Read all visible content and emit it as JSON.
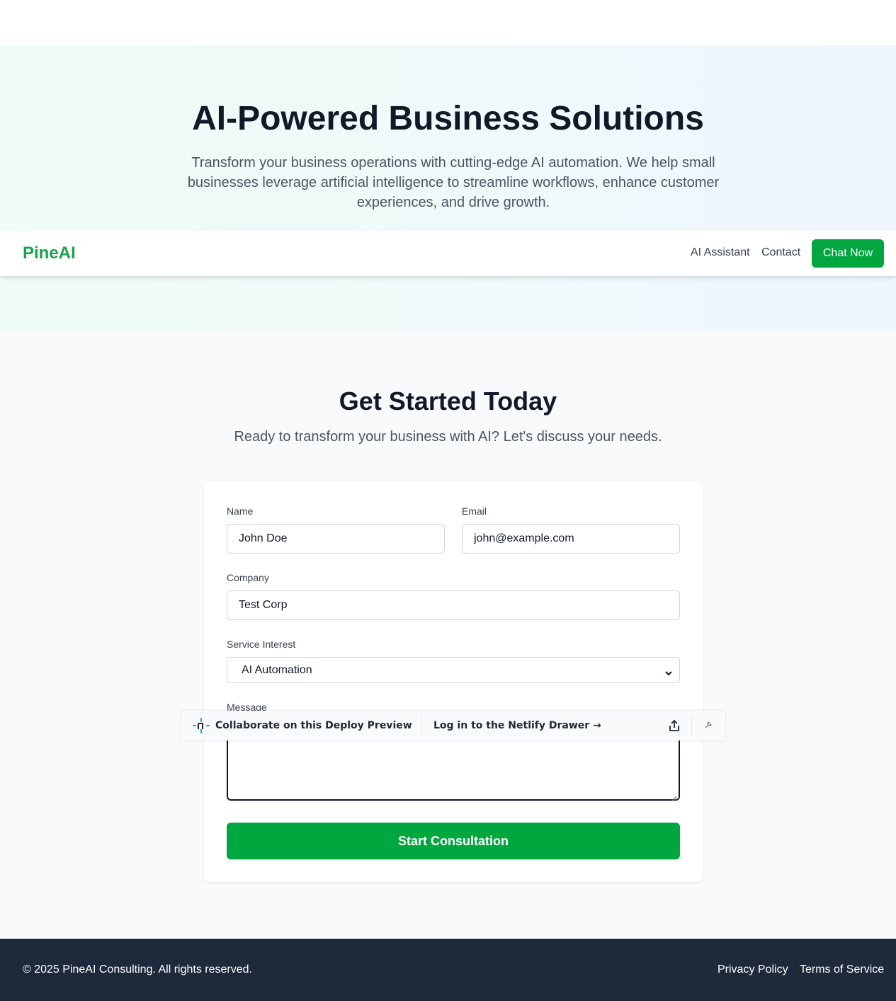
{
  "hero": {
    "title": "AI-Powered Business Solutions",
    "subtitle": "Transform your business operations with cutting-edge AI automation. We help small businesses leverage artificial intelligence to streamline workflows, enhance customer experiences, and drive growth."
  },
  "navbar": {
    "brand": "PineAI",
    "links": [
      "AI Assistant",
      "Contact"
    ],
    "cta_label": "Chat Now"
  },
  "contact": {
    "title": "Get Started Today",
    "subtitle": "Ready to transform your business with AI? Let's discuss your needs.",
    "form": {
      "name_label": "Name",
      "name_value": "John Doe",
      "email_label": "Email",
      "email_value": "john@example.com",
      "company_label": "Company",
      "company_value": "Test Corp",
      "service_label": "Service Interest",
      "service_value": "AI Automation",
      "message_label": "Message",
      "message_value": "",
      "submit_label": "Start Consultation"
    }
  },
  "netlify_drawer": {
    "collab_label": "Collaborate on this Deploy Preview",
    "login_label": "Log in to the Netlify Drawer →",
    "icons": [
      "netlify-logo-icon",
      "share-icon",
      "pin-icon"
    ]
  },
  "footer": {
    "copyright": "© 2025 PineAI Consulting. All rights reserved.",
    "links": [
      "Privacy Policy",
      "Terms of Service"
    ]
  },
  "colors": {
    "brand_green": "#16a34a",
    "button_green": "#00a63e",
    "footer_bg": "#1e293b"
  }
}
